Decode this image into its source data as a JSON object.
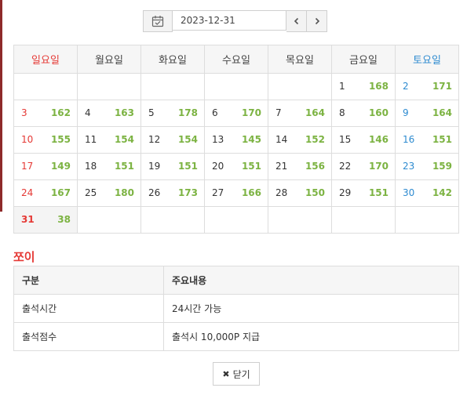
{
  "datepicker": {
    "date": "2023-12-31",
    "calendar_icon": "calendar-icon",
    "prev_icon": "chevron-left-icon",
    "next_icon": "chevron-right-icon"
  },
  "calendar": {
    "weekdays": [
      "일요일",
      "월요일",
      "화요일",
      "수요일",
      "목요일",
      "금요일",
      "토요일"
    ],
    "weeks": [
      [
        null,
        null,
        null,
        null,
        null,
        {
          "day": "1",
          "points": "168"
        },
        {
          "day": "2",
          "points": "171"
        }
      ],
      [
        {
          "day": "3",
          "points": "162"
        },
        {
          "day": "4",
          "points": "163"
        },
        {
          "day": "5",
          "points": "178"
        },
        {
          "day": "6",
          "points": "170"
        },
        {
          "day": "7",
          "points": "164"
        },
        {
          "day": "8",
          "points": "160"
        },
        {
          "day": "9",
          "points": "164"
        }
      ],
      [
        {
          "day": "10",
          "points": "155"
        },
        {
          "day": "11",
          "points": "154"
        },
        {
          "day": "12",
          "points": "154"
        },
        {
          "day": "13",
          "points": "145"
        },
        {
          "day": "14",
          "points": "152"
        },
        {
          "day": "15",
          "points": "146"
        },
        {
          "day": "16",
          "points": "151"
        }
      ],
      [
        {
          "day": "17",
          "points": "149"
        },
        {
          "day": "18",
          "points": "151"
        },
        {
          "day": "19",
          "points": "151"
        },
        {
          "day": "20",
          "points": "151"
        },
        {
          "day": "21",
          "points": "156"
        },
        {
          "day": "22",
          "points": "170"
        },
        {
          "day": "23",
          "points": "159"
        }
      ],
      [
        {
          "day": "24",
          "points": "167"
        },
        {
          "day": "25",
          "points": "180"
        },
        {
          "day": "26",
          "points": "173"
        },
        {
          "day": "27",
          "points": "166"
        },
        {
          "day": "28",
          "points": "150"
        },
        {
          "day": "29",
          "points": "151"
        },
        {
          "day": "30",
          "points": "142"
        }
      ],
      [
        {
          "day": "31",
          "points": "38",
          "today": true
        },
        null,
        null,
        null,
        null,
        null,
        null
      ]
    ],
    "colors": {
      "sunday": "#e53935",
      "saturday": "#2e8bd0",
      "points": "#7cb342"
    }
  },
  "section": {
    "title": "쪼이"
  },
  "info": {
    "headers": [
      "구분",
      "주요내용"
    ],
    "rows": [
      [
        "출석시간",
        "24시간 가능"
      ],
      [
        "출석점수",
        "출석시 10,000P 지급"
      ]
    ]
  },
  "close_button": {
    "label": "닫기",
    "icon": "close-icon"
  }
}
